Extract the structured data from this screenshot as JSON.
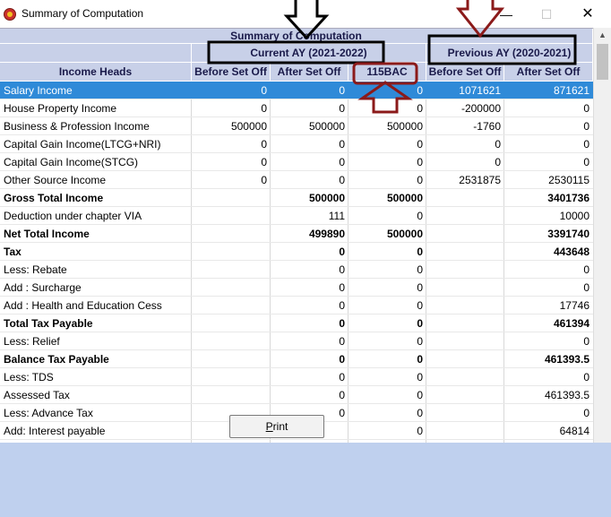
{
  "window": {
    "title": "Summary of Computation",
    "min_label": "—",
    "max_label": "☐",
    "close_label": "✕"
  },
  "table": {
    "banner": "Summary of Computation",
    "current_ay": "Current AY (2021-2022)",
    "previous_ay": "Previous AY (2020-2021)",
    "columns": [
      "Income Heads",
      "Before Set Off",
      "After Set Off",
      "115BAC",
      "Before Set Off",
      "After Set Off"
    ],
    "rows": [
      {
        "head": "Salary Income",
        "v": [
          "0",
          "0",
          "0",
          "1071621",
          "871621"
        ],
        "bold": false,
        "selected": true
      },
      {
        "head": "House Property Income",
        "v": [
          "0",
          "0",
          "0",
          "-200000",
          "0"
        ],
        "bold": false,
        "selected": false
      },
      {
        "head": "Business & Profession Income",
        "v": [
          "500000",
          "500000",
          "500000",
          "-1760",
          "0"
        ],
        "bold": false,
        "selected": false
      },
      {
        "head": "Capital Gain Income(LTCG+NRI)",
        "v": [
          "0",
          "0",
          "0",
          "0",
          "0"
        ],
        "bold": false,
        "selected": false
      },
      {
        "head": "Capital Gain Income(STCG)",
        "v": [
          "0",
          "0",
          "0",
          "0",
          "0"
        ],
        "bold": false,
        "selected": false
      },
      {
        "head": "Other Source Income",
        "v": [
          "0",
          "0",
          "0",
          "2531875",
          "2530115"
        ],
        "bold": false,
        "selected": false
      },
      {
        "head": "Gross Total Income",
        "v": [
          "",
          "500000",
          "500000",
          "",
          "3401736"
        ],
        "bold": true,
        "selected": false
      },
      {
        "head": "Deduction under chapter VIA",
        "v": [
          "",
          "111",
          "0",
          "",
          "10000"
        ],
        "bold": false,
        "selected": false
      },
      {
        "head": "Net Total Income",
        "v": [
          "",
          "499890",
          "500000",
          "",
          "3391740"
        ],
        "bold": true,
        "selected": false
      },
      {
        "head": "Tax",
        "v": [
          "",
          "0",
          "0",
          "",
          "443648"
        ],
        "bold": true,
        "selected": false
      },
      {
        "head": "Less: Rebate",
        "v": [
          "",
          "0",
          "0",
          "",
          "0"
        ],
        "bold": false,
        "selected": false
      },
      {
        "head": "Add : Surcharge",
        "v": [
          "",
          "0",
          "0",
          "",
          "0"
        ],
        "bold": false,
        "selected": false
      },
      {
        "head": "Add : Health and Education Cess",
        "v": [
          "",
          "0",
          "0",
          "",
          "17746"
        ],
        "bold": false,
        "selected": false
      },
      {
        "head": "Total Tax Payable",
        "v": [
          "",
          "0",
          "0",
          "",
          "461394"
        ],
        "bold": true,
        "selected": false
      },
      {
        "head": "Less: Relief",
        "v": [
          "",
          "0",
          "0",
          "",
          "0"
        ],
        "bold": false,
        "selected": false
      },
      {
        "head": "Balance Tax Payable",
        "v": [
          "",
          "0",
          "0",
          "",
          "461393.5"
        ],
        "bold": true,
        "selected": false
      },
      {
        "head": "Less: TDS",
        "v": [
          "",
          "0",
          "0",
          "",
          "0"
        ],
        "bold": false,
        "selected": false
      },
      {
        "head": "Assessed Tax",
        "v": [
          "",
          "0",
          "0",
          "",
          "461393.5"
        ],
        "bold": false,
        "selected": false
      },
      {
        "head": "Less: Advance Tax",
        "v": [
          "",
          "0",
          "0",
          "",
          "0"
        ],
        "bold": false,
        "selected": false
      },
      {
        "head": "Add: Interest payable",
        "v": [
          "",
          "",
          "0",
          "",
          "64814"
        ],
        "bold": false,
        "selected": false
      }
    ]
  },
  "print_button": {
    "label_underlined": "P",
    "label_rest": "rint"
  },
  "annotations": {
    "black": "#000000",
    "maroon": "#8b1a1a"
  }
}
